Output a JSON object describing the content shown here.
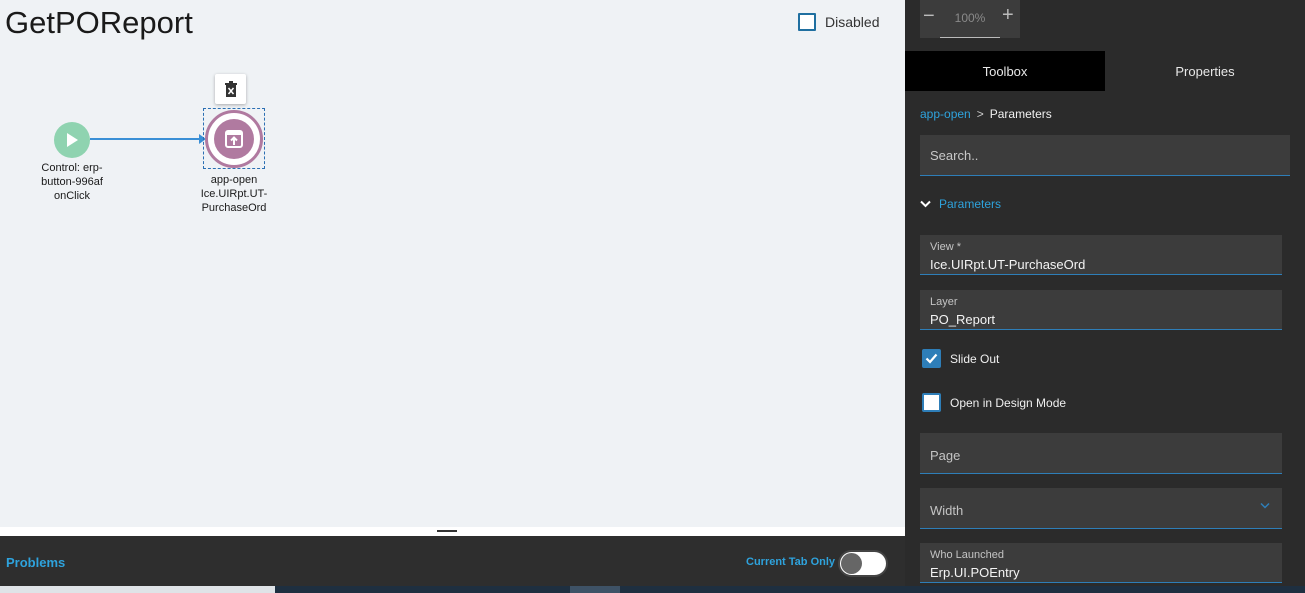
{
  "canvas": {
    "title": "GetPOReport",
    "disabled_label": "Disabled",
    "start_node": {
      "label": "Control: erp-\nbutton-996af\nonClick",
      "color": "#8fd3b0"
    },
    "app_node": {
      "title": "app-open",
      "line2": "Ice.UIRpt.UT-",
      "line3": "PurchaseOrd",
      "color": "#b07aa0"
    }
  },
  "problems": {
    "label": "Problems",
    "current_tab_only_label": "Current Tab Only"
  },
  "zoom": {
    "minus": "−",
    "value": "100%",
    "plus": "+"
  },
  "tabs": [
    {
      "label": "Toolbox",
      "active": true
    },
    {
      "label": "Properties",
      "active": false
    }
  ],
  "breadcrumb": {
    "link": "app-open",
    "separator": ">",
    "current": "Parameters"
  },
  "search": {
    "placeholder": "Search.."
  },
  "parameters": {
    "header": "Parameters",
    "view": {
      "label": "View *",
      "value": "Ice.UIRpt.UT-PurchaseOrd"
    },
    "layer": {
      "label": "Layer",
      "value": "PO_Report"
    },
    "slide_out": {
      "label": "Slide Out",
      "checked": true
    },
    "design_mode": {
      "label": "Open in Design Mode",
      "checked": false
    },
    "page": {
      "label": "Page"
    },
    "width": {
      "label": "Width"
    },
    "who_launched": {
      "label": "Who Launched",
      "value": "Erp.UI.POEntry"
    }
  },
  "colors": {
    "accent": "#2ea3dd",
    "panel_bg": "#2b2b2b",
    "field_bg": "#3c3c3c"
  }
}
